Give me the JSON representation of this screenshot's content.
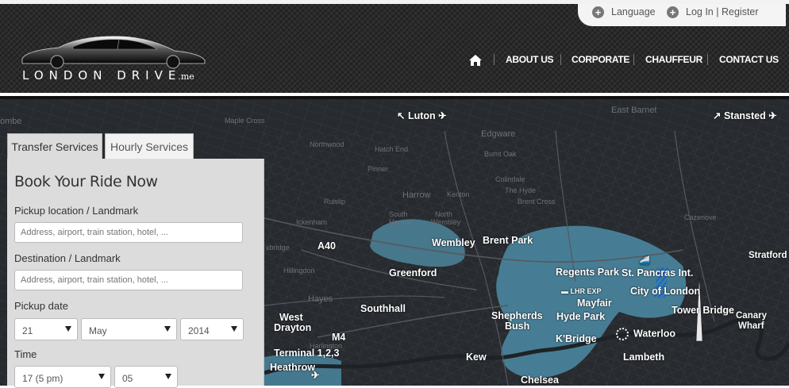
{
  "brand": {
    "logo_text": "LONDON DRIVE",
    "logo_suffix": ".me"
  },
  "utility": {
    "language": "Language",
    "login": "Log In",
    "separator": "|",
    "register": "Register"
  },
  "nav": {
    "home_icon": "home-icon",
    "items": [
      "ABOUT US",
      "CORPORATE",
      "CHAUFFEUR",
      "CONTACT US"
    ]
  },
  "booking": {
    "tabs": [
      "Transfer Services",
      "Hourly Services"
    ],
    "title": "Book Your Ride Now",
    "pickup_label": "Pickup location / Landmark",
    "pickup_placeholder": "Address, airport, train station, hotel, ...",
    "destination_label": "Destination / Landmark",
    "destination_placeholder": "Address, airport, train station, hotel, ...",
    "date_label": "Pickup date",
    "date_day": "21",
    "date_month": "May",
    "date_year": "2014",
    "time_label": "Time",
    "time_hour": "17 (5 pm)",
    "time_minute": "05"
  },
  "map": {
    "labels": {
      "luton": "Luton",
      "stansted": "Stansted",
      "a40": "A40",
      "wembley": "Wembley",
      "brent_park": "Brent Park",
      "greenford": "Greenford",
      "regents_park": "Regents Park",
      "st_pancras": "St. Pancras Int.",
      "lhr_exp": "LHR EXP",
      "city_of_london": "City of London",
      "mayfair": "Mayfair",
      "southhall": "Southhall",
      "west": "West",
      "drayton": "Drayton",
      "shepherds": "Shepherds",
      "bush": "Bush",
      "hyde_park": "Hyde Park",
      "tower_bridge": "Tower Bridge",
      "canary": "Canary",
      "wharf": "Wharf",
      "stratford": "Stratford",
      "m4": "M4",
      "kbridge": "K'Bridge",
      "waterloo": "Waterloo",
      "terminal": "Terminal 1,2,3",
      "heathrow": "Heathrow",
      "kew": "Kew",
      "lambeth": "Lambeth",
      "chelsea": "Chelsea"
    },
    "faint_labels": {
      "maple_cross": "Maple Cross",
      "northwood": "Northwood",
      "pinner": "Pinner",
      "harrow": "Harrow",
      "kenton": "Kenton",
      "edgware": "Edgware",
      "east_barnet": "East Barnet",
      "hatch_end": "Hatch End",
      "burnt_oak": "Burnt Oak",
      "colindale": "Colindale",
      "the_hyde": "The Hyde",
      "brent_cross": "Brent Cross",
      "ruislip": "Ruislip",
      "ickenham": "Ickenham",
      "south_harrow": "South",
      "south_harrow2": "Harrow",
      "north_wembley": "North",
      "north_wembley2": "Wembley",
      "uxbridge": "xbridge",
      "hillingdon": "Hillingdon",
      "hayes": "Hayes",
      "harlington": "Harlington",
      "combe": "ombe",
      "cazenove": "Cazenove"
    }
  }
}
